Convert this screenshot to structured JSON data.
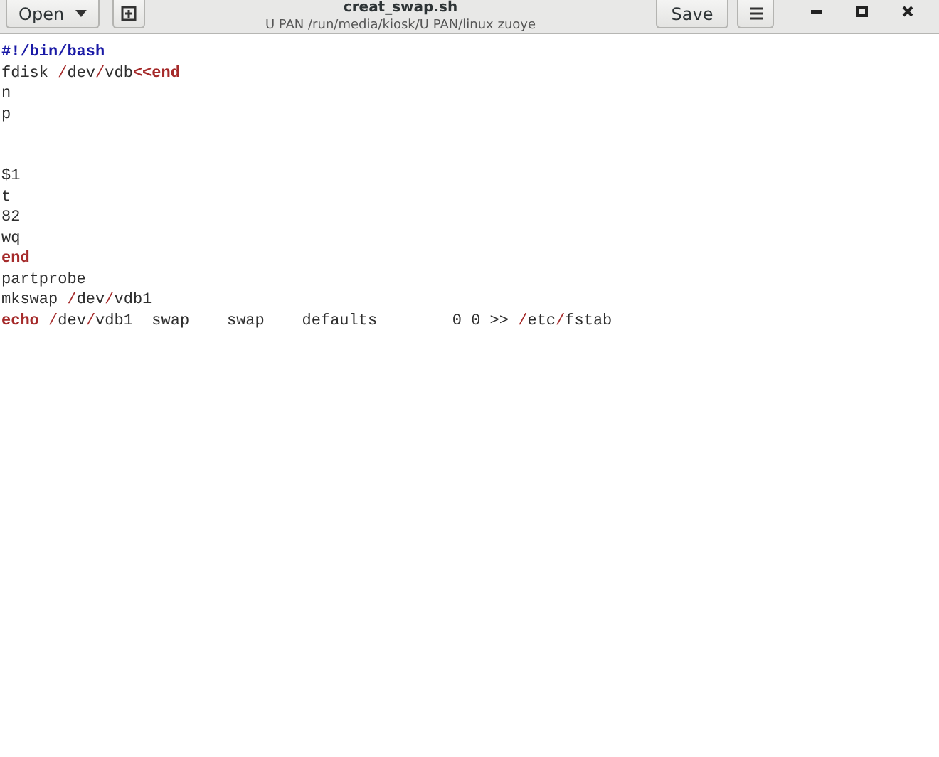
{
  "header": {
    "open_button": "Open",
    "title": "creat_swap.sh",
    "subtitle": "U PAN /run/media/kiosk/U PAN/linux zuoye",
    "save_button": "Save"
  },
  "editor": {
    "lines": [
      {
        "segments": [
          {
            "kind": "shebang",
            "text": "#!/bin/bash"
          }
        ]
      },
      {
        "segments": [
          {
            "kind": "plain",
            "text": "fdisk "
          },
          {
            "kind": "slash",
            "text": "/"
          },
          {
            "kind": "plain",
            "text": "dev"
          },
          {
            "kind": "slash",
            "text": "/"
          },
          {
            "kind": "plain",
            "text": "vdb"
          },
          {
            "kind": "keyword",
            "text": "<<end"
          }
        ]
      },
      {
        "segments": [
          {
            "kind": "plain",
            "text": "n"
          }
        ]
      },
      {
        "segments": [
          {
            "kind": "plain",
            "text": "p"
          }
        ]
      },
      {
        "kind": "blank"
      },
      {
        "kind": "blank"
      },
      {
        "segments": [
          {
            "kind": "plain",
            "text": "$1"
          }
        ]
      },
      {
        "segments": [
          {
            "kind": "plain",
            "text": "t"
          }
        ]
      },
      {
        "segments": [
          {
            "kind": "plain",
            "text": "82"
          }
        ]
      },
      {
        "segments": [
          {
            "kind": "plain",
            "text": "wq"
          }
        ]
      },
      {
        "segments": [
          {
            "kind": "keyword",
            "text": "end"
          }
        ]
      },
      {
        "segments": [
          {
            "kind": "plain",
            "text": "partprobe"
          }
        ]
      },
      {
        "segments": [
          {
            "kind": "plain",
            "text": "mkswap "
          },
          {
            "kind": "slash",
            "text": "/"
          },
          {
            "kind": "plain",
            "text": "dev"
          },
          {
            "kind": "slash",
            "text": "/"
          },
          {
            "kind": "plain",
            "text": "vdb1"
          }
        ]
      },
      {
        "segments": [
          {
            "kind": "keyword",
            "text": "echo "
          },
          {
            "kind": "slash",
            "text": "/"
          },
          {
            "kind": "plain",
            "text": "dev"
          },
          {
            "kind": "slash",
            "text": "/"
          },
          {
            "kind": "plain",
            "text": "vdb1  swap    swap    defaults        0 0 >> "
          },
          {
            "kind": "slash",
            "text": "/"
          },
          {
            "kind": "plain",
            "text": "etc"
          },
          {
            "kind": "slash",
            "text": "/"
          },
          {
            "kind": "plain",
            "text": "fstab"
          }
        ]
      }
    ]
  }
}
